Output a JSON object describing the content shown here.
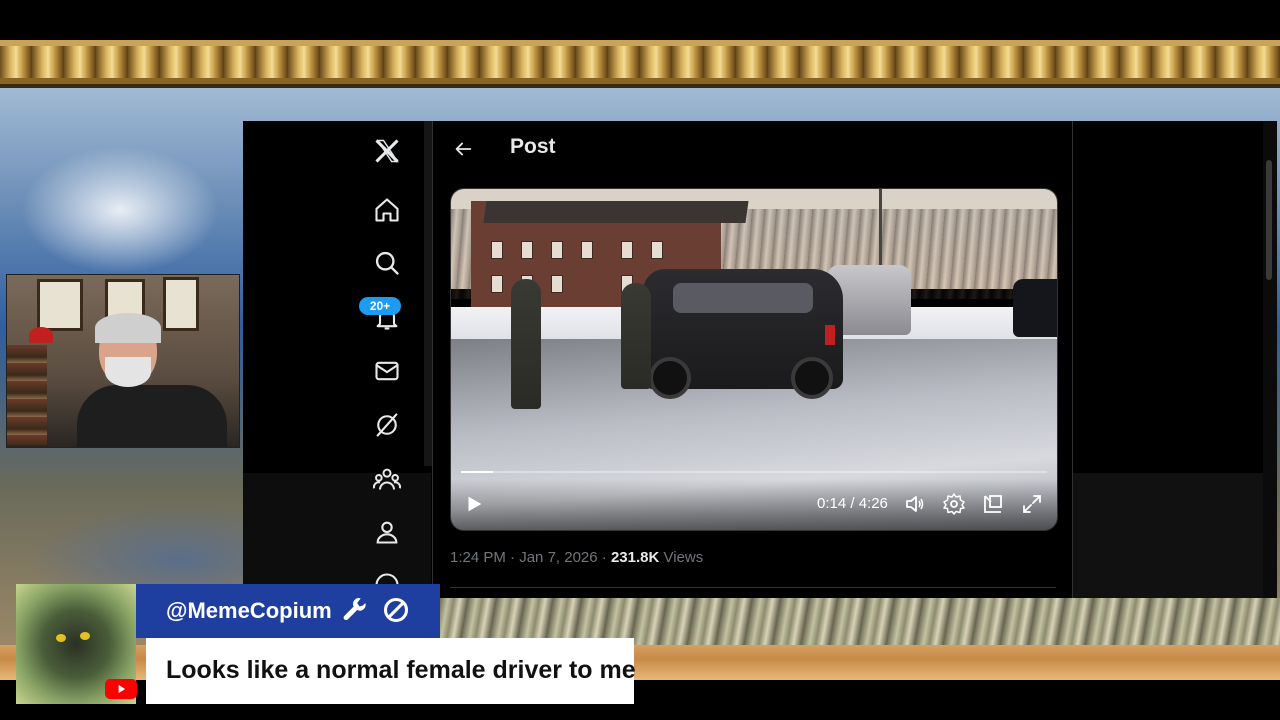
{
  "x_nav": {
    "items": [
      {
        "name": "x-logo-icon"
      },
      {
        "name": "home-icon"
      },
      {
        "name": "search-icon"
      },
      {
        "name": "notifications-icon",
        "badge": "20+"
      },
      {
        "name": "messages-icon"
      },
      {
        "name": "grok-icon"
      },
      {
        "name": "communities-icon"
      },
      {
        "name": "profile-icon"
      }
    ]
  },
  "post": {
    "title": "Post",
    "video": {
      "current_time": "0:14",
      "duration": "4:26",
      "time_display": "0:14 / 4:26",
      "progress_fraction": 0.055
    },
    "meta": {
      "time": "1:24 PM",
      "date": "Jan 7, 2026",
      "views_count": "231.8K",
      "views_label": "Views"
    }
  },
  "chat": {
    "username": "@MemeCopium",
    "message": "Looks like a normal female driver to me",
    "platform_icon": "youtube-icon"
  },
  "colors": {
    "accent": "#1d9bf0",
    "chat_name_bg": "#1f3fa0",
    "youtube_red": "#ff0000"
  }
}
